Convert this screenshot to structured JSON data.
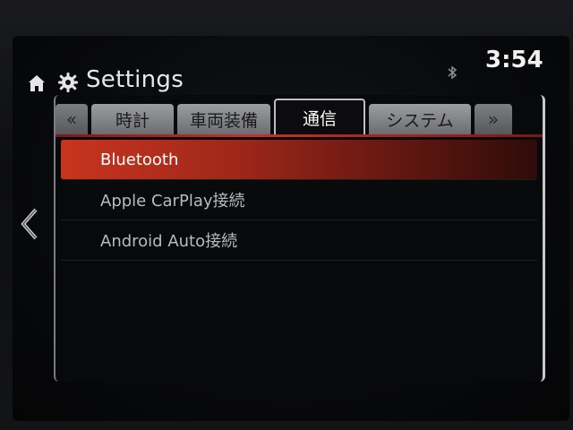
{
  "header": {
    "title": "Settings",
    "time": "3:54"
  },
  "tabs": [
    {
      "label": "«",
      "kind": "arrow"
    },
    {
      "label": "時計",
      "kind": "tab"
    },
    {
      "label": "車両装備",
      "kind": "tab"
    },
    {
      "label": "通信",
      "kind": "active"
    },
    {
      "label": "システム",
      "kind": "tab"
    },
    {
      "label": "»",
      "kind": "arrow"
    }
  ],
  "menu": {
    "items": [
      {
        "label": "Bluetooth",
        "selected": true
      },
      {
        "label": "Apple CarPlay接続",
        "selected": false
      },
      {
        "label": "Android Auto接続",
        "selected": false
      }
    ]
  },
  "colors": {
    "accent": "#c8341f",
    "background": "#08090b",
    "text": "#b9babd"
  },
  "icons": {
    "home": "home-icon",
    "settings": "gear-icon",
    "bluetooth": "bluetooth-icon",
    "back": "chevron-left-icon"
  }
}
